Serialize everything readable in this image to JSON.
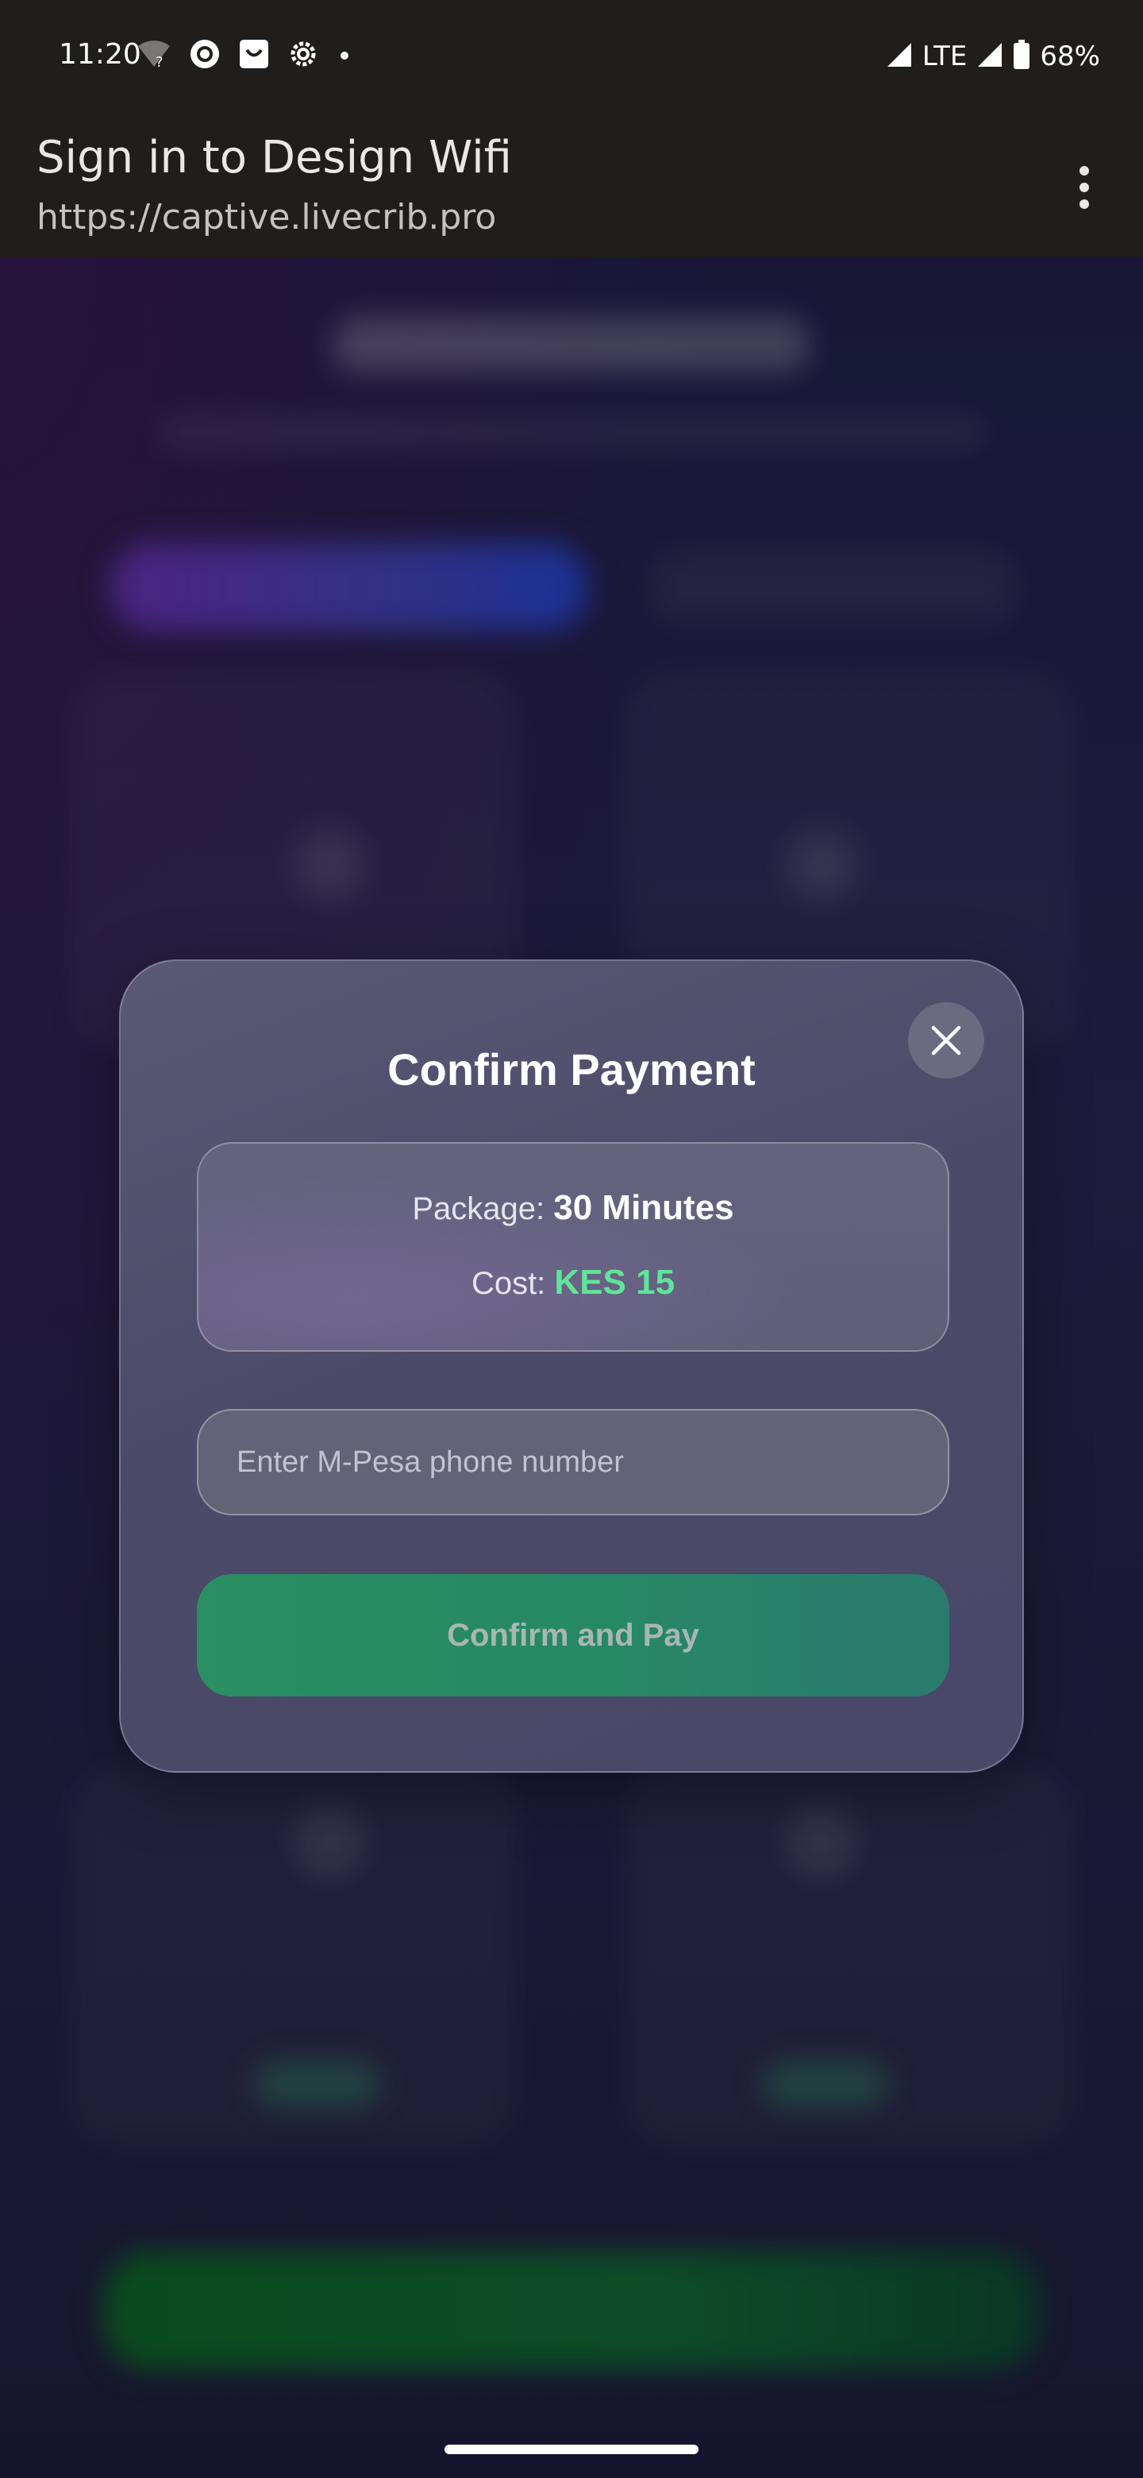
{
  "status_bar": {
    "time": "11:20",
    "network": "LTE",
    "battery": "68%",
    "icons": [
      "wifi-question-icon",
      "circle-o-icon",
      "smile-box-icon",
      "gear-icon",
      "dot-icon",
      "signal-icon",
      "signal-icon",
      "battery-icon"
    ]
  },
  "browser": {
    "title": "Sign in to Design Wifi",
    "url": "https://captive.livecrib.pro",
    "menu_icon": "more-vert-icon"
  },
  "modal": {
    "title": "Confirm Payment",
    "close_icon": "close-icon",
    "package_label": "Package:",
    "package_value": "30 Minutes",
    "cost_label": "Cost:",
    "cost_value": "KES 15",
    "phone_placeholder": "Enter M-Pesa phone number",
    "phone_value": "",
    "pay_button_label": "Confirm and Pay"
  },
  "colors": {
    "accent_green": "#5fe59a",
    "pay_button": "#2a8f62",
    "status_bar_bg": "#201d1b"
  }
}
